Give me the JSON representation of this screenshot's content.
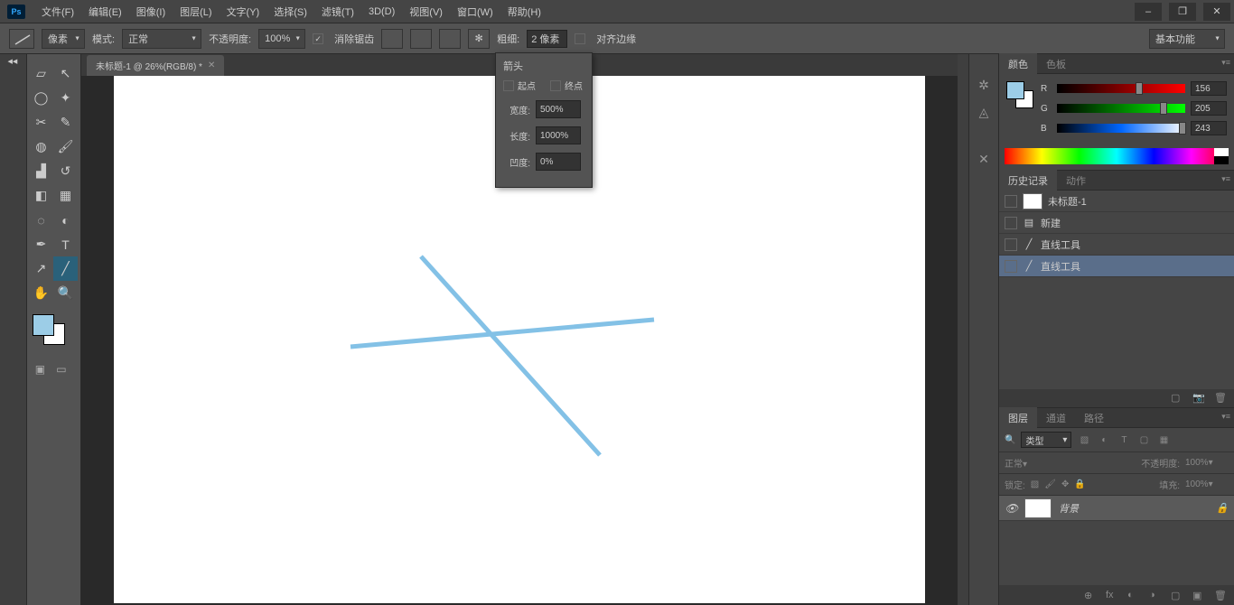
{
  "app": {
    "logo": "Ps"
  },
  "menu": [
    "文件(F)",
    "编辑(E)",
    "图像(I)",
    "图层(L)",
    "文字(Y)",
    "选择(S)",
    "滤镜(T)",
    "3D(D)",
    "视图(V)",
    "窗口(W)",
    "帮助(H)"
  ],
  "options": {
    "unit": "像素",
    "mode_label": "模式:",
    "mode_value": "正常",
    "opacity_label": "不透明度:",
    "opacity_value": "100%",
    "antialias_label": "消除锯齿",
    "weight_label": "粗细:",
    "weight_value": "2 像素",
    "align_label": "对齐边缘",
    "workspace": "基本功能"
  },
  "arrow_popup": {
    "title": "箭头",
    "start_label": "起点",
    "end_label": "终点",
    "width_label": "宽度:",
    "width_value": "500%",
    "length_label": "长度:",
    "length_value": "1000%",
    "concave_label": "凹度:",
    "concave_value": "0%"
  },
  "tab": {
    "title": "未标题-1 @ 26%(RGB/8) *"
  },
  "color_panel": {
    "tabs": [
      "颜色",
      "色板"
    ],
    "channels": [
      {
        "ch": "R",
        "val": "156",
        "pct": 61
      },
      {
        "ch": "G",
        "val": "205",
        "pct": 80
      },
      {
        "ch": "B",
        "val": "243",
        "pct": 95
      }
    ]
  },
  "history_panel": {
    "tabs": [
      "历史记录",
      "动作"
    ],
    "doc": "未标题-1",
    "items": [
      {
        "icon": "▤",
        "label": "新建"
      },
      {
        "icon": "╱",
        "label": "直线工具"
      },
      {
        "icon": "╱",
        "label": "直线工具"
      }
    ]
  },
  "layers_panel": {
    "tabs": [
      "图层",
      "通道",
      "路径"
    ],
    "type_label": "类型",
    "blend_mode": "正常",
    "opacity_label": "不透明度:",
    "opacity_value": "100%",
    "lock_label": "锁定:",
    "fill_label": "填充:",
    "fill_value": "100%",
    "layer_name": "背景"
  }
}
